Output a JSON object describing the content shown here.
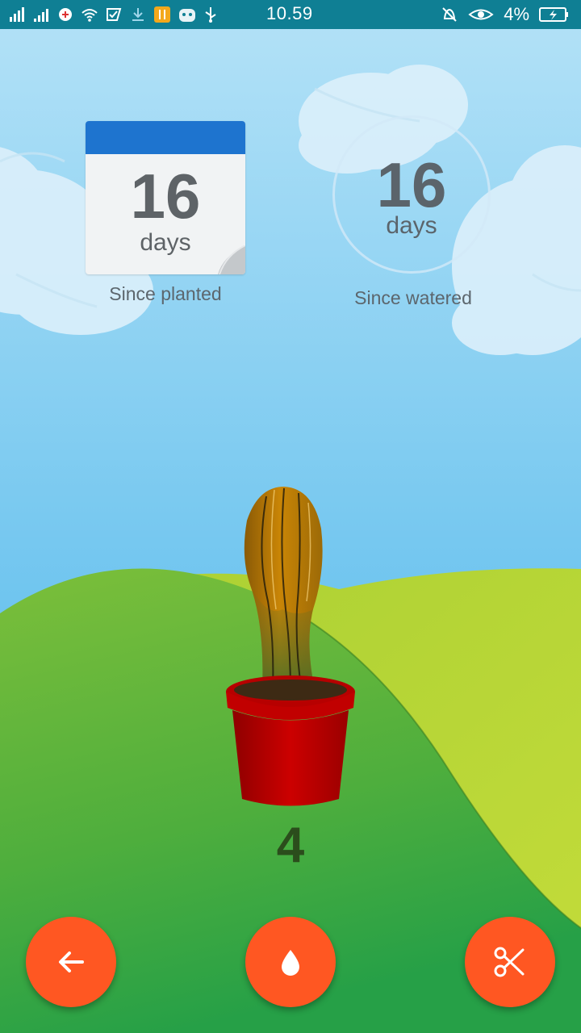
{
  "status_bar": {
    "time": "10.59",
    "battery_percent": "4%",
    "icons": [
      "signal-icon",
      "signal-icon",
      "vpn-icon",
      "wifi-icon",
      "check-app-icon",
      "download-icon",
      "tools-app-icon",
      "android-icon",
      "usb-icon",
      "bell-off-icon",
      "eye-icon",
      "battery-charging-icon"
    ]
  },
  "planted": {
    "count": "16",
    "unit": "days",
    "caption": "Since planted"
  },
  "watered": {
    "count": "16",
    "unit": "days",
    "caption": "Since watered"
  },
  "plant": {
    "level": "4"
  },
  "actions": {
    "back_icon": "arrow-left-icon",
    "water_icon": "water-drop-icon",
    "prune_icon": "scissors-icon"
  },
  "colors": {
    "status_bar": "#0f7f94",
    "sky_top": "#b4e2f7",
    "sky_bottom": "#4cb6ec",
    "calendar_header": "#1e74cf",
    "fab": "#ff5722",
    "pot": "#c40000",
    "level_text": "#2b4d1c"
  }
}
